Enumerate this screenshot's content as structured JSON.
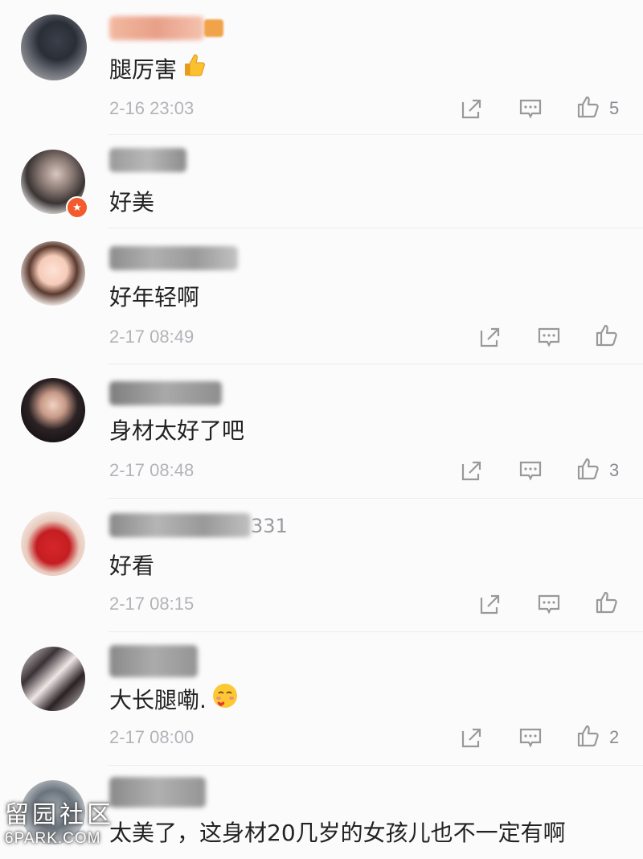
{
  "comments": [
    {
      "text": "腿厉害",
      "emoji": "thumbs-up-emoji",
      "time": "2-16 23:03",
      "likes": "5",
      "username_visible": ""
    },
    {
      "text": "好美",
      "emoji": "",
      "time": "",
      "likes": "",
      "username_visible": ""
    },
    {
      "text": "好年轻啊",
      "emoji": "",
      "time": "2-17 08:49",
      "likes": "",
      "username_visible": ""
    },
    {
      "text": "身材太好了吧",
      "emoji": "",
      "time": "2-17 08:48",
      "likes": "3",
      "username_visible": ""
    },
    {
      "text": "好看",
      "emoji": "",
      "time": "2-17 08:15",
      "likes": "",
      "username_visible": "331"
    },
    {
      "text": "大长腿嘞.",
      "emoji": "blush-heart-emoji",
      "time": "2-17 08:00",
      "likes": "2",
      "username_visible": ""
    },
    {
      "text": "太美了，这身材20几岁的女孩儿也不一定有啊",
      "emoji": "",
      "time": "",
      "likes": "",
      "username_visible": ""
    }
  ],
  "watermark": {
    "cn": "留园社区",
    "en": "6PARK.COM"
  },
  "icons": {
    "share": "share-icon",
    "reply": "comment-icon",
    "like": "thumbs-up-icon"
  },
  "colors": {
    "time": "#b3b3b8",
    "badge": "#f35a2d",
    "text": "#222222"
  }
}
